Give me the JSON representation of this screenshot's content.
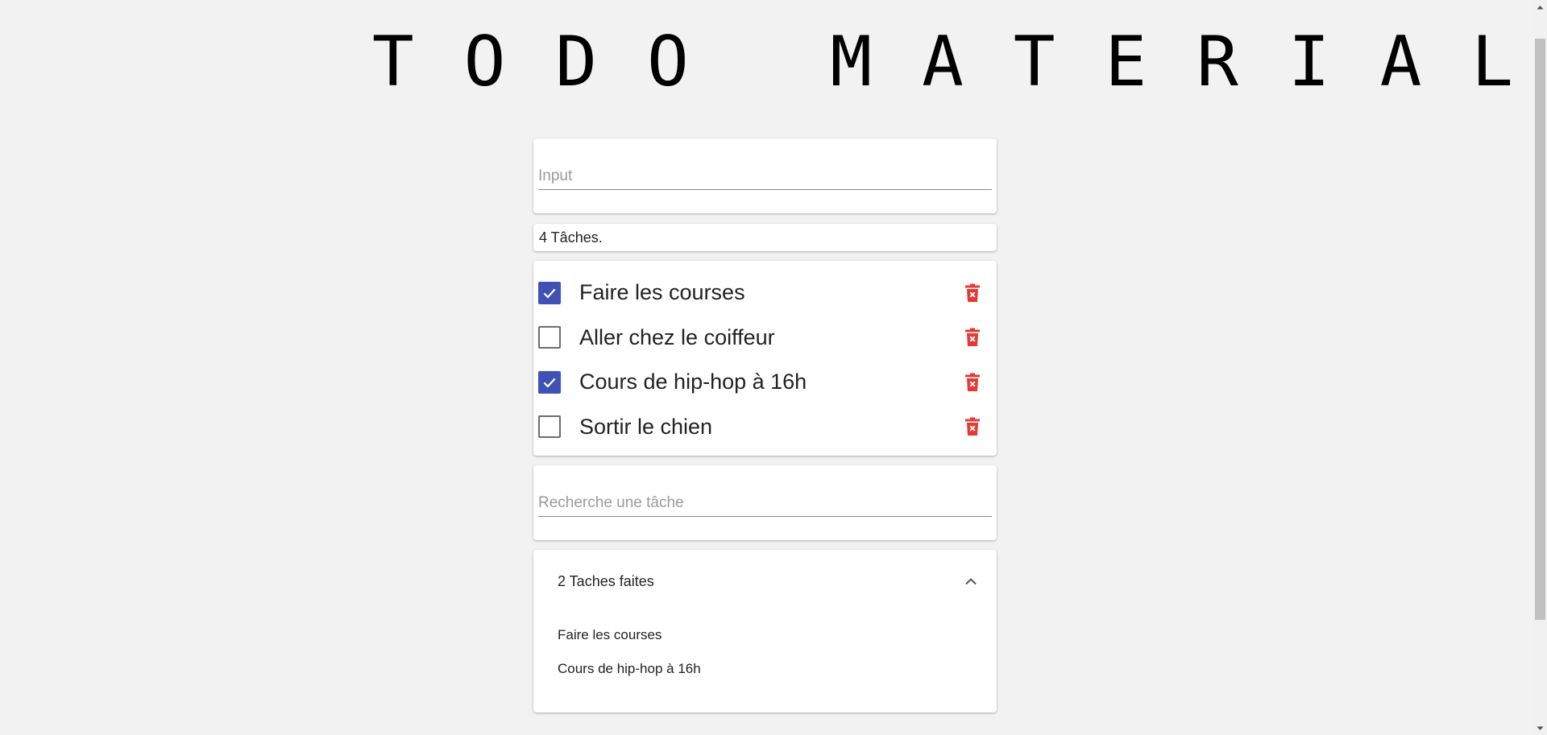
{
  "app": {
    "logo_text": "TODO MATERIAL"
  },
  "new_task": {
    "placeholder": "Input",
    "value": ""
  },
  "task_count": {
    "label": "4 Tâches."
  },
  "tasks": [
    {
      "label": "Faire les courses",
      "checked": true
    },
    {
      "label": "Aller chez le coiffeur",
      "checked": false
    },
    {
      "label": "Cours de hip-hop à 16h",
      "checked": true
    },
    {
      "label": "Sortir le chien",
      "checked": false
    }
  ],
  "search": {
    "placeholder": "Recherche une tâche",
    "value": ""
  },
  "done_panel": {
    "title": "2 Taches faites",
    "expanded": true,
    "items": [
      "Faire les courses",
      "Cours de hip-hop à 16h"
    ]
  },
  "icons": {
    "checkbox_check": "check-icon",
    "delete": "delete-forever-icon",
    "expand": "chevron-up-icon"
  },
  "colors": {
    "background": "#f2f2f2",
    "card": "#ffffff",
    "checkbox_checked": "#3f51b5",
    "delete_icon": "#e53935",
    "logo": "#000000"
  }
}
